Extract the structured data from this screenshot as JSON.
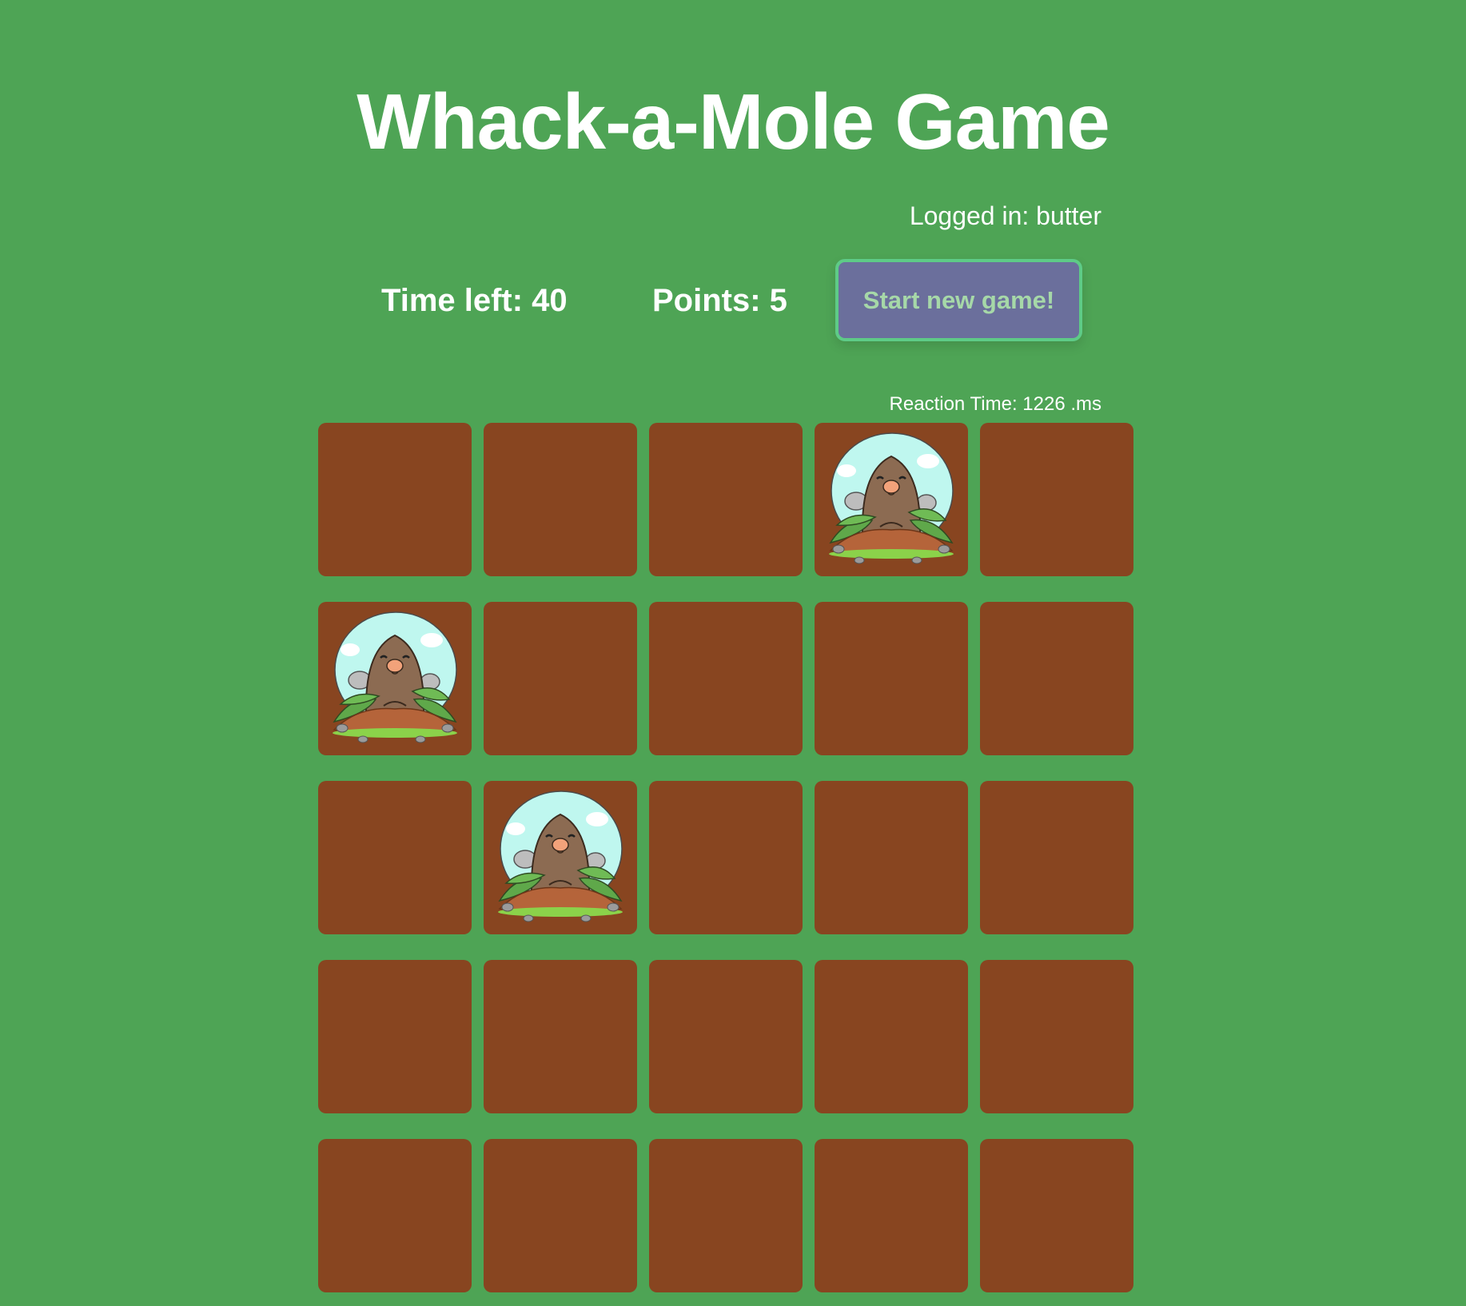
{
  "title": "Whack-a-Mole Game",
  "logged_in": "Logged in: butter",
  "time_left": "Time left: 40",
  "points": "Points: 5",
  "start_button": "Start new game!",
  "reaction_time": "Reaction Time: 1226 .ms",
  "grid": {
    "rows": 5,
    "cols": 5,
    "moles": [
      [
        0,
        3
      ],
      [
        1,
        0
      ],
      [
        2,
        1
      ]
    ]
  },
  "colors": {
    "background": "#4ea455",
    "hole": "#884520",
    "button": "#6b6f9c",
    "button_border": "#5ecb87"
  }
}
